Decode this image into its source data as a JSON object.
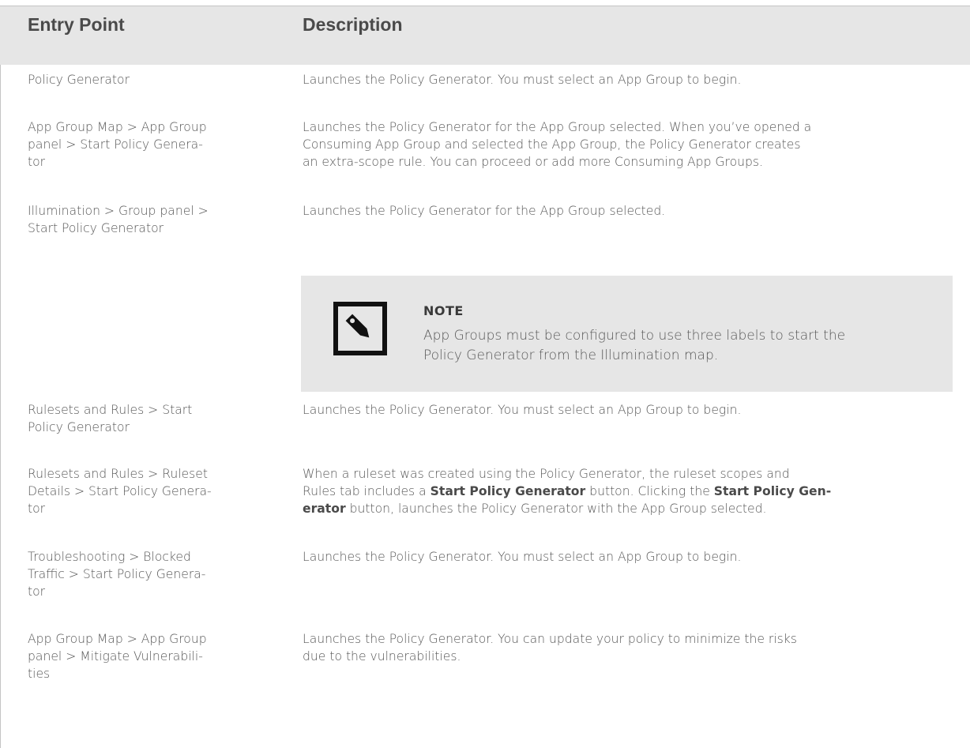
{
  "header": {
    "col1": "Entry Point",
    "col2": "Description"
  },
  "rows": [
    {
      "entry": "Policy Generator",
      "description": "Launches the Policy Generator. You must select an App Group to begin."
    },
    {
      "entry": "App Group Map > App Group panel > Start Policy Genera-tor",
      "entry_lines": [
        "App Group Map > App Group",
        "panel > Start Policy Genera-",
        "tor"
      ],
      "description": "Launches the Policy Generator for the App Group selected. When you’ve opened a Consuming App Group and selected the App Group, the Policy Generator creates an extra-scope rule. You can proceed or add more Consuming App Groups.",
      "description_lines": [
        "Launches the Policy Generator for the App Group selected. When you’ve opened a",
        "Consuming App Group and selected the App Group, the Policy Generator creates",
        "an extra-scope rule. You can proceed or add more Consuming App Groups."
      ]
    },
    {
      "entry_lines": [
        "Illumination > Group panel >",
        "Start Policy Generator"
      ],
      "description": "Launches the Policy Generator for the App Group selected."
    },
    {
      "entry_lines": [
        "Rulesets and Rules > Start",
        "Policy Generator"
      ],
      "description": "Launches the Policy Generator. You must select an App Group to begin."
    },
    {
      "entry_lines": [
        "Rulesets and Rules > Ruleset",
        "Details > Start Policy Genera-",
        "tor"
      ],
      "description_parts": {
        "line1": "When a ruleset was created using the Policy Generator, the ruleset scopes and",
        "line2_pre": "Rules tab includes a ",
        "line2_bold": "Start Policy Generator",
        "line2_mid": " button. Clicking the ",
        "line2_bold2": "Start Policy Gen-",
        "line3_bold": "erator",
        "line3_post": " button, launches the Policy Generator with the App Group selected."
      }
    },
    {
      "entry_lines": [
        "Troubleshooting > Blocked",
        "Traffic > Start Policy Genera-",
        "tor"
      ],
      "description": "Launches the Policy Generator. You must select an App Group to begin."
    },
    {
      "entry_lines": [
        "App Group Map > App Group",
        "panel > Mitigate Vulnerabili-",
        "ties"
      ],
      "description_lines": [
        "Launches the Policy Generator. You can update your policy to minimize the risks",
        "due to the vulnerabilities."
      ]
    }
  ],
  "note": {
    "title": "NOTE",
    "icon": "tag-icon",
    "text_lines": [
      "App Groups must be configured to use three labels to start the",
      "Policy Generator from the Illumination map."
    ]
  }
}
